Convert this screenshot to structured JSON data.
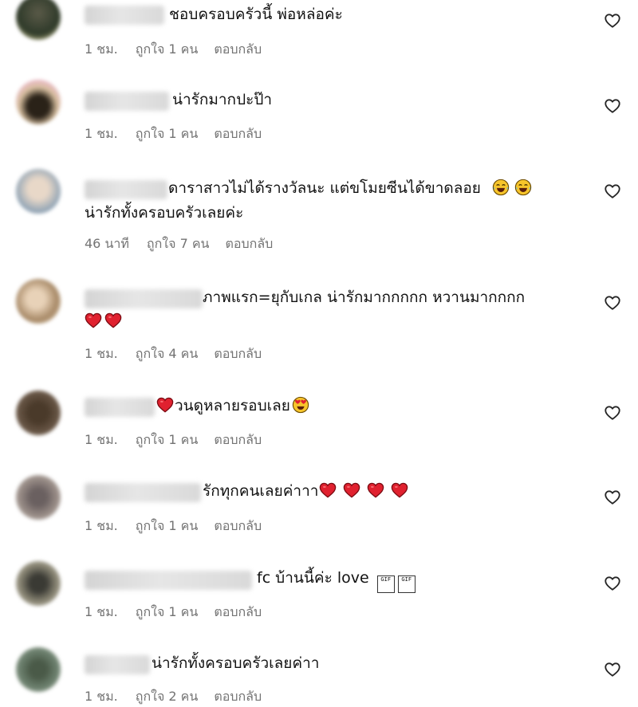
{
  "comments": [
    {
      "text": "ชอบครอบครัวนี้ พ่อหล่อค่ะ",
      "time": "1 ชม.",
      "likes": "ถูกใจ 1 คน",
      "reply": "ตอบกลับ"
    },
    {
      "text": "น่ารักมากปะป๊า",
      "time": "1 ชม.",
      "likes": "ถูกใจ 1 คน",
      "reply": "ตอบกลับ"
    },
    {
      "text": "ดาราสาวไม่ได้รางวัลนะ แต่ขโมยซีนได้ขาดลอย",
      "text2": "น่ารักทั้งครอบครัวเลยค่ะ",
      "time": "46 นาที",
      "likes": "ถูกใจ 7 คน",
      "reply": "ตอบกลับ"
    },
    {
      "text": "ภาพแรก=ยุกับเกล น่ารักมากกกกก หวานมากกกก",
      "time": "1 ชม.",
      "likes": "ถูกใจ 4 คน",
      "reply": "ตอบกลับ"
    },
    {
      "text": "วนดูหลายรอบเลย",
      "time": "1 ชม.",
      "likes": "ถูกใจ 1 คน",
      "reply": "ตอบกลับ"
    },
    {
      "text": "รักทุกคนเลยค่าาา",
      "time": "1 ชม.",
      "likes": "ถูกใจ 1 คน",
      "reply": "ตอบกลับ"
    },
    {
      "text": "fc บ้านนี้ค่ะ love",
      "gif": "GIF",
      "time": "1 ชม.",
      "likes": "ถูกใจ 1 คน",
      "reply": "ตอบกลับ"
    },
    {
      "text": "น่ารักทั้งครอบครัวเลยค่าา",
      "time": "1 ชม.",
      "likes": "ถูกใจ 2 คน",
      "reply": "ตอบกลับ"
    }
  ],
  "icons": {
    "like_button": "heart-outline-icon",
    "laugh": "tears-of-joy-emoji",
    "red_heart": "red-heart-emoji",
    "heart_eyes": "heart-eyes-emoji"
  },
  "colors": {
    "meta_text": "#737373",
    "emoji_heart": "#e0212f",
    "emoji_face": "#f7c52b"
  }
}
